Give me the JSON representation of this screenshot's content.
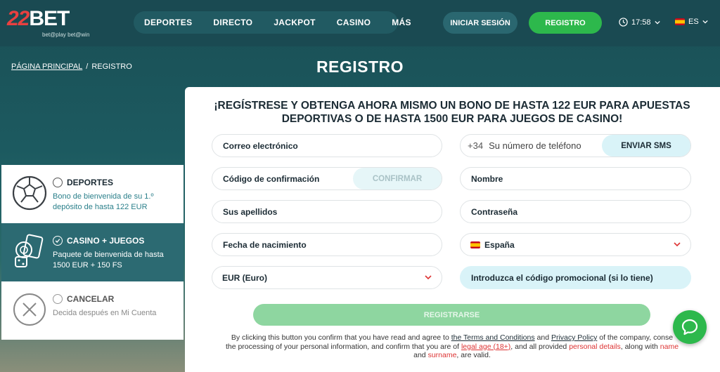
{
  "header": {
    "logo_main_22": "22",
    "logo_main_bet": "BET",
    "logo_sub": "bet@play bet@win",
    "nav": [
      "DEPORTES",
      "DIRECTO",
      "JACKPOT",
      "CASINO",
      "MÁS"
    ],
    "login_label": "INICIAR SESIÓN",
    "register_label": "REGISTRO",
    "time": "17:58",
    "language": "ES"
  },
  "breadcrumb": {
    "home": "PÁGINA PRINCIPAL",
    "separator": "/",
    "current": "REGISTRO"
  },
  "page_title": "REGISTRO",
  "bonus": {
    "deportes": {
      "title": "DEPORTES",
      "desc": "Bono de bienvenida de su 1.º depósito de hasta 122 EUR"
    },
    "casino": {
      "title": "CASINO + JUEGOS",
      "desc": "Paquete de bienvenida de hasta 1500 EUR + 150 FS"
    },
    "cancelar": {
      "title": "CANCELAR",
      "desc": "Decida después en Mi Cuenta"
    },
    "selected": "casino"
  },
  "form": {
    "headline": "¡REGÍSTRESE Y OBTENGA AHORA MISMO UN BONO DE HASTA 122 EUR PARA APUESTAS DEPORTIVAS O DE HASTA 1500 EUR PARA JUEGOS DE CASINO!",
    "email_placeholder": "Correo electrónico",
    "phone_prefix": "+34",
    "phone_placeholder": "Su número de teléfono",
    "send_sms_label": "ENVIAR SMS",
    "confirmation_code_placeholder": "Código de confirmación",
    "confirm_label": "CONFIRMAR",
    "name_placeholder": "Nombre",
    "surname_placeholder": "Sus apellidos",
    "password_placeholder": "Contraseña",
    "birthdate_placeholder": "Fecha de nacimiento",
    "country_value": "España",
    "currency_value": "EUR (Euro)",
    "promo_placeholder": "Introduzca el código promocional (si lo tiene)",
    "submit_label": "REGISTRARSE"
  },
  "legal": {
    "p1": "By clicking this button you confirm that you have read and agree to ",
    "terms": "the Terms and Conditions",
    "p2": " and ",
    "privacy": "Privacy Policy",
    "p3": " of the company, conse",
    "p4": "the processing of your personal information, and confirm that you are of ",
    "legal_age": "legal age (18+)",
    "p5": ", and all provided ",
    "personal_details": "personal details",
    "p6": ", along with ",
    "name": "name",
    "p7": " and ",
    "surname": "surname",
    "p8": ", are valid."
  },
  "colors": {
    "brand_green": "#2db84c",
    "header_bg": "#1a4a52",
    "accent_teal": "#2c6a72",
    "promo_bg": "#d9f3f8"
  },
  "icons": [
    "football-icon",
    "casino-chips-icon",
    "cancel-icon",
    "clock-icon",
    "chevron-down-icon",
    "chat-icon",
    "check-icon"
  ]
}
